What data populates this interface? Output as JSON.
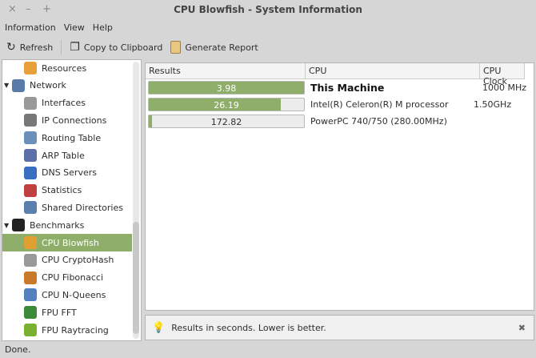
{
  "window": {
    "title": "CPU Blowfish - System Information",
    "close": "×",
    "minimize": "–",
    "maximize": "+"
  },
  "menu": [
    "Information",
    "View",
    "Help"
  ],
  "toolbar": {
    "refresh": "Refresh",
    "copy": "Copy to Clipboard",
    "report": "Generate Report"
  },
  "sidebar": {
    "items": [
      {
        "label": "Resources",
        "level": 1,
        "color": "#e8a13a"
      },
      {
        "label": "Network",
        "level": 0,
        "color": "#5a7aa8",
        "expander": "▼"
      },
      {
        "label": "Interfaces",
        "level": 1,
        "color": "#999"
      },
      {
        "label": "IP Connections",
        "level": 1,
        "color": "#777"
      },
      {
        "label": "Routing Table",
        "level": 1,
        "color": "#6a8fb8"
      },
      {
        "label": "ARP Table",
        "level": 1,
        "color": "#5b6fa8"
      },
      {
        "label": "DNS Servers",
        "level": 1,
        "color": "#3a6ec0"
      },
      {
        "label": "Statistics",
        "level": 1,
        "color": "#c04040"
      },
      {
        "label": "Shared Directories",
        "level": 1,
        "color": "#5a80b0"
      },
      {
        "label": "Benchmarks",
        "level": 0,
        "color": "#222",
        "expander": "▼"
      },
      {
        "label": "CPU Blowfish",
        "level": 1,
        "color": "#e0a030",
        "selected": true
      },
      {
        "label": "CPU CryptoHash",
        "level": 1,
        "color": "#999"
      },
      {
        "label": "CPU Fibonacci",
        "level": 1,
        "color": "#c87a2a"
      },
      {
        "label": "CPU N-Queens",
        "level": 1,
        "color": "#5580c0"
      },
      {
        "label": "FPU FFT",
        "level": 1,
        "color": "#3a8a3a"
      },
      {
        "label": "FPU Raytracing",
        "level": 1,
        "color": "#7ab030"
      }
    ]
  },
  "table": {
    "headers": [
      "Results",
      "CPU",
      "CPU Clock"
    ],
    "rows": [
      {
        "result": "3.98",
        "fill": 1.0,
        "cpu": "This Machine",
        "clock": "1000 MHz",
        "bold": true
      },
      {
        "result": "26.19",
        "fill": 0.85,
        "cpu": "Intel(R) Celeron(R) M processor         1.50GHz",
        "clock": ""
      },
      {
        "result": "172.82",
        "fill": 0.02,
        "cpu": "PowerPC 740/750 (280.00MHz)",
        "clock": ""
      }
    ]
  },
  "info": {
    "text": "Results in seconds. Lower is better.",
    "close": "✖"
  },
  "status": "Done.",
  "colors": {
    "accent": "#8eae6a"
  }
}
